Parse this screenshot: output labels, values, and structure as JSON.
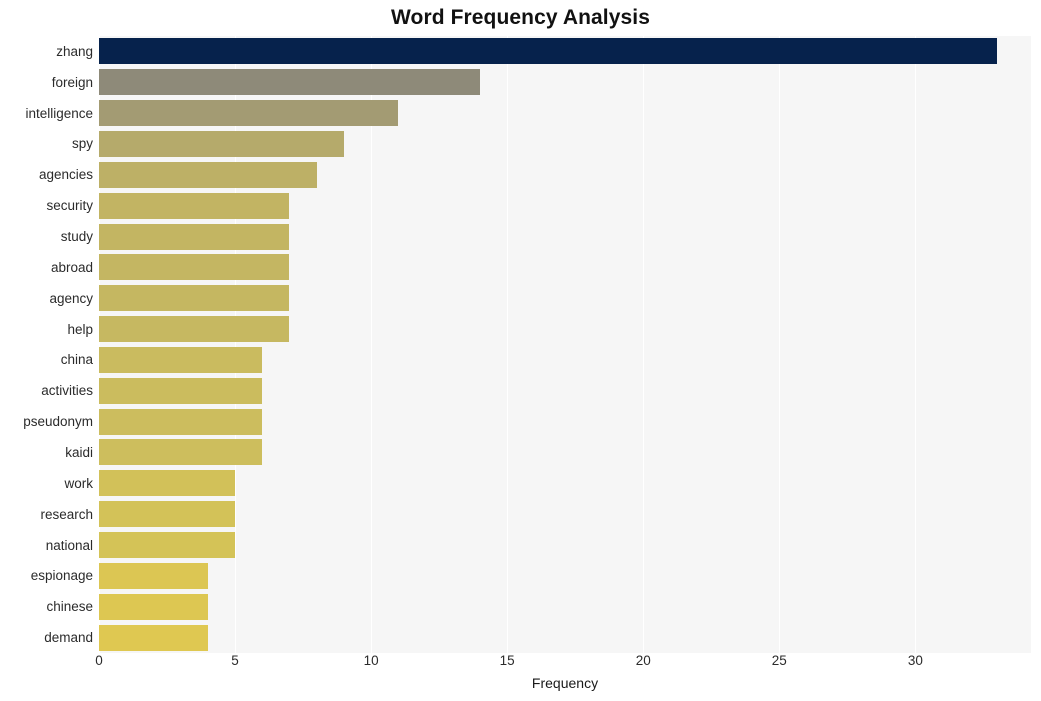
{
  "chart_data": {
    "type": "bar",
    "orientation": "horizontal",
    "title": "Word Frequency Analysis",
    "xlabel": "Frequency",
    "ylabel": "",
    "categories": [
      "zhang",
      "foreign",
      "intelligence",
      "spy",
      "agencies",
      "security",
      "study",
      "abroad",
      "agency",
      "help",
      "china",
      "activities",
      "pseudonym",
      "kaidi",
      "work",
      "research",
      "national",
      "espionage",
      "chinese",
      "demand"
    ],
    "values": [
      33,
      14,
      11,
      9,
      8,
      7,
      7,
      7,
      7,
      7,
      6,
      6,
      6,
      6,
      5,
      5,
      5,
      4,
      4,
      4
    ],
    "bar_colors": [
      "#06224c",
      "#8e8a79",
      "#a39b73",
      "#b5aa6b",
      "#bdb066",
      "#c2b463",
      "#c3b562",
      "#c4b662",
      "#c5b761",
      "#c6b861",
      "#cabb5f",
      "#cbbc5e",
      "#ccbd5e",
      "#cdbe5d",
      "#d2c159",
      "#d3c258",
      "#d4c357",
      "#dcc653",
      "#ddc752",
      "#dfc851"
    ],
    "xlim": [
      0,
      34.25
    ],
    "x_ticks": [
      0,
      5,
      10,
      15,
      20,
      25,
      30
    ],
    "x_tick_labels": [
      "0",
      "5",
      "10",
      "15",
      "20",
      "25",
      "30"
    ],
    "grid": {
      "vertical": true,
      "horizontal": false,
      "color": "#ffffff"
    },
    "legend": null,
    "plot_background": "#f6f6f6",
    "figure_background": "#ffffff"
  }
}
